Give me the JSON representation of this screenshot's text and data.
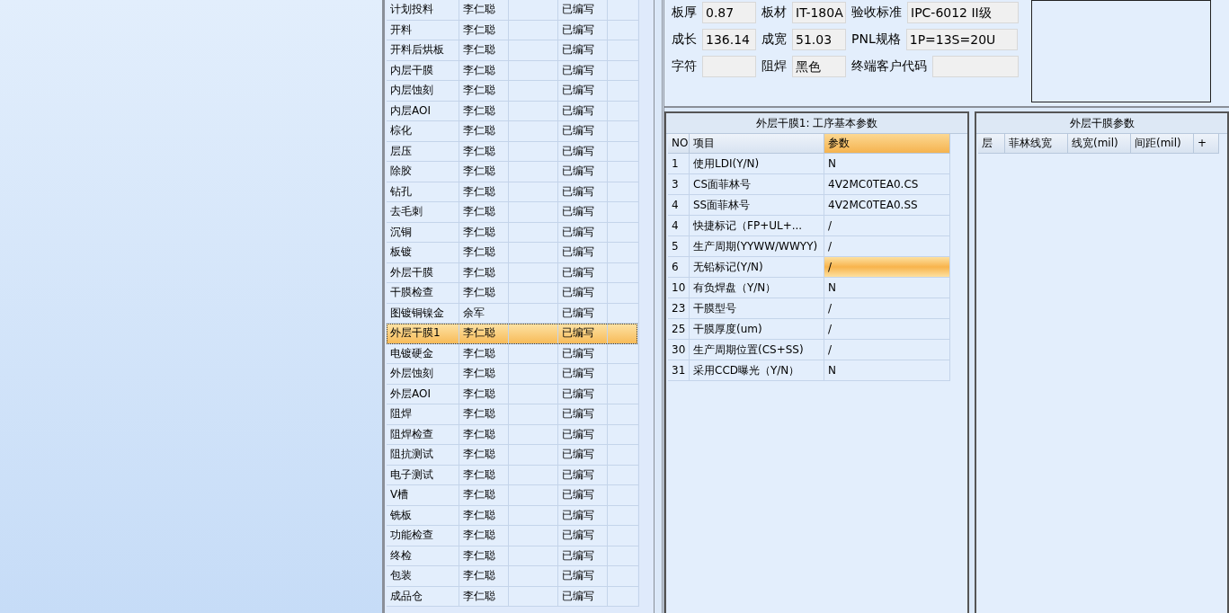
{
  "process_list": {
    "rows": [
      {
        "process": "计划投料",
        "person": "李仁聪",
        "status": "已编写",
        "selected": false
      },
      {
        "process": "开料",
        "person": "李仁聪",
        "status": "已编写",
        "selected": false
      },
      {
        "process": "开料后烘板",
        "person": "李仁聪",
        "status": "已编写",
        "selected": false
      },
      {
        "process": "内层干膜",
        "person": "李仁聪",
        "status": "已编写",
        "selected": false
      },
      {
        "process": "内层蚀刻",
        "person": "李仁聪",
        "status": "已编写",
        "selected": false
      },
      {
        "process": "内层AOI",
        "person": "李仁聪",
        "status": "已编写",
        "selected": false
      },
      {
        "process": "棕化",
        "person": "李仁聪",
        "status": "已编写",
        "selected": false
      },
      {
        "process": "层压",
        "person": "李仁聪",
        "status": "已编写",
        "selected": false
      },
      {
        "process": "除胶",
        "person": "李仁聪",
        "status": "已编写",
        "selected": false
      },
      {
        "process": "钻孔",
        "person": "李仁聪",
        "status": "已编写",
        "selected": false
      },
      {
        "process": "去毛刺",
        "person": "李仁聪",
        "status": "已编写",
        "selected": false
      },
      {
        "process": "沉铜",
        "person": "李仁聪",
        "status": "已编写",
        "selected": false
      },
      {
        "process": "板镀",
        "person": "李仁聪",
        "status": "已编写",
        "selected": false
      },
      {
        "process": "外层干膜",
        "person": "李仁聪",
        "status": "已编写",
        "selected": false
      },
      {
        "process": "干膜检查",
        "person": "李仁聪",
        "status": "已编写",
        "selected": false
      },
      {
        "process": "图镀铜镍金",
        "person": "余军",
        "status": "已编写",
        "selected": false
      },
      {
        "process": "外层干膜1",
        "person": "李仁聪",
        "status": "已编写",
        "selected": true
      },
      {
        "process": "电镀硬金",
        "person": "李仁聪",
        "status": "已编写",
        "selected": false
      },
      {
        "process": "外层蚀刻",
        "person": "李仁聪",
        "status": "已编写",
        "selected": false
      },
      {
        "process": "外层AOI",
        "person": "李仁聪",
        "status": "已编写",
        "selected": false
      },
      {
        "process": "阻焊",
        "person": "李仁聪",
        "status": "已编写",
        "selected": false
      },
      {
        "process": "阻焊检查",
        "person": "李仁聪",
        "status": "已编写",
        "selected": false
      },
      {
        "process": "阻抗测试",
        "person": "李仁聪",
        "status": "已编写",
        "selected": false
      },
      {
        "process": "电子测试",
        "person": "李仁聪",
        "status": "已编写",
        "selected": false
      },
      {
        "process": "V槽",
        "person": "李仁聪",
        "status": "已编写",
        "selected": false
      },
      {
        "process": "铣板",
        "person": "李仁聪",
        "status": "已编写",
        "selected": false
      },
      {
        "process": "功能检查",
        "person": "李仁聪",
        "status": "已编写",
        "selected": false
      },
      {
        "process": "终检",
        "person": "李仁聪",
        "status": "已编写",
        "selected": false
      },
      {
        "process": "包装",
        "person": "李仁聪",
        "status": "已编写",
        "selected": false
      },
      {
        "process": "成品仓",
        "person": "李仁聪",
        "status": "已编写",
        "selected": false
      }
    ]
  },
  "board_info": {
    "rows": [
      [
        {
          "label": "板厚",
          "value": "0.87"
        },
        {
          "label": "板材",
          "value": "IT-180A"
        },
        {
          "label": "验收标准",
          "value": "IPC-6012 II级"
        }
      ],
      [
        {
          "label": "成长",
          "value": "136.14"
        },
        {
          "label": "成宽",
          "value": "51.03"
        },
        {
          "label": "PNL规格",
          "value": "1P=13S=20U"
        }
      ],
      [
        {
          "label": "字符"
        },
        {
          "label": "阻焊",
          "value": "黑色"
        },
        {
          "label": "终端客户代码"
        }
      ]
    ]
  },
  "basic_params": {
    "title": "外层干膜1: 工序基本参数",
    "columns": [
      "NO",
      "项目",
      "参数"
    ],
    "rows": [
      {
        "no": "1",
        "item": "使用LDI(Y/N)",
        "value": "N",
        "selected": false
      },
      {
        "no": "3",
        "item": "CS面菲林号",
        "value": "4V2MC0TEA0.CS",
        "selected": false
      },
      {
        "no": "4",
        "item": "SS面菲林号",
        "value": "4V2MC0TEA0.SS",
        "selected": false
      },
      {
        "no": "4",
        "item": "快捷标记（FP+UL+...",
        "value": "/",
        "selected": false
      },
      {
        "no": "5",
        "item": "生产周期(YYWW/WWYY)",
        "value": "/",
        "selected": false
      },
      {
        "no": "6",
        "item": "无铅标记(Y/N)",
        "value": "/",
        "selected": true
      },
      {
        "no": "10",
        "item": "有负焊盘（Y/N）",
        "value": "N",
        "selected": false
      },
      {
        "no": "23",
        "item": "干膜型号",
        "value": "/",
        "selected": false
      },
      {
        "no": "25",
        "item": "干膜厚度(um)",
        "value": "/",
        "selected": false
      },
      {
        "no": "30",
        "item": "生产周期位置(CS+SS)",
        "value": "/",
        "selected": false
      },
      {
        "no": "31",
        "item": "采用CCD曝光（Y/N）",
        "value": "N",
        "selected": false
      }
    ]
  },
  "film_params": {
    "title": "外层干膜参数",
    "columns": [
      "层",
      "菲林线宽",
      "线宽(mil)",
      "间距(mil)",
      "+"
    ]
  }
}
